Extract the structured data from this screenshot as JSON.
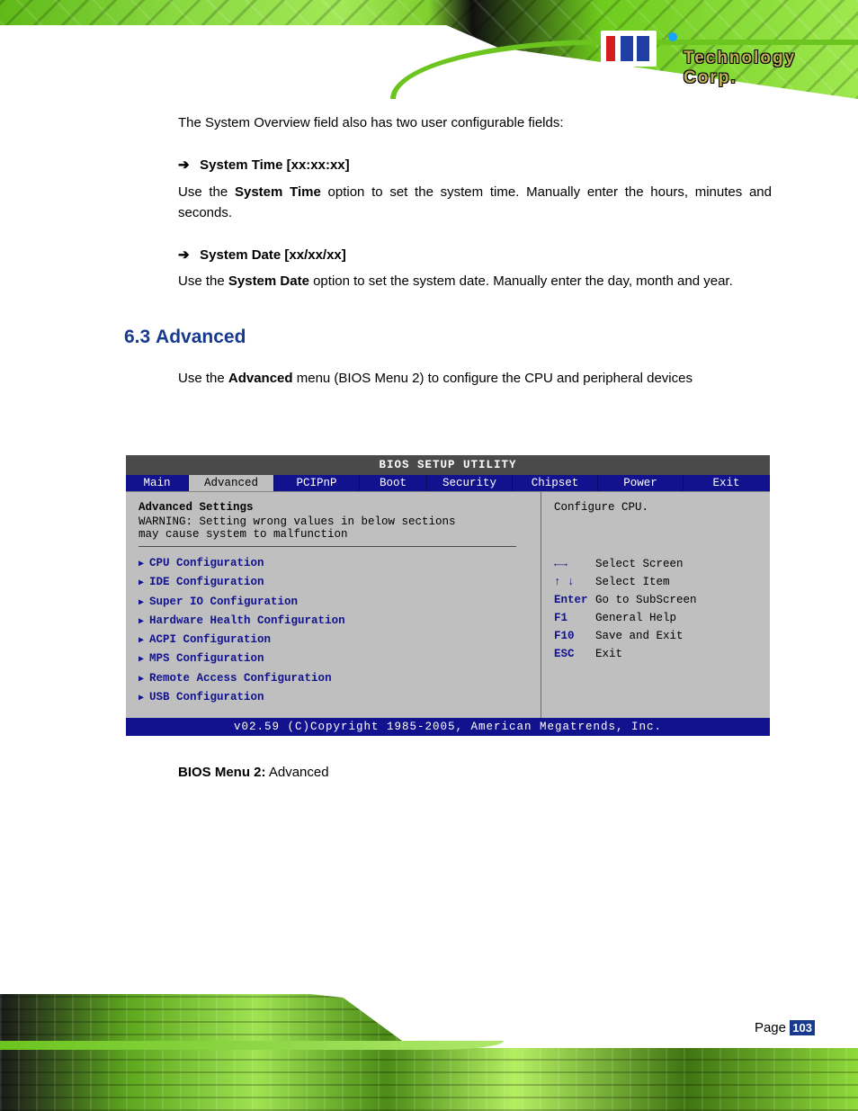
{
  "header": {
    "brand_text": "Technology Corp.",
    "reg": "®"
  },
  "body": {
    "intro": "The System Overview field also has two user configurable fields:",
    "item1": {
      "label": "System Time [xx:xx:xx]",
      "text_before": "Use the ",
      "bold": "System Time",
      "text_after": " option to set the system time. Manually enter the hours, minutes and seconds."
    },
    "item2": {
      "label": "System Date [xx/xx/xx]",
      "text_before": "Use the ",
      "bold": "System Date",
      "text_after": " option to set the system date. Manually enter the day, month and year."
    },
    "section_number": "6.3",
    "section_title": "Advanced",
    "adv_intro_before": "Use the ",
    "adv_intro_bold": "Advanced",
    "adv_intro_after": " menu (BIOS Menu 2) to configure the CPU and peripheral devices"
  },
  "bios": {
    "title": "BIOS SETUP UTILITY",
    "tabs": [
      "Main",
      "Advanced",
      "PCIPnP",
      "Boot",
      "Security",
      "Chipset",
      "Power",
      "Exit"
    ],
    "active_tab_index": 1,
    "left": {
      "heading": "Advanced Settings",
      "warning_line1": "WARNING: Setting wrong values in below sections",
      "warning_line2": "         may cause system to malfunction",
      "menu": [
        "CPU Configuration",
        "IDE Configuration",
        "Super IO Configuration",
        "Hardware Health Configuration",
        "ACPI Configuration",
        "MPS Configuration",
        "Remote Access Configuration",
        "USB Configuration"
      ]
    },
    "right": {
      "help": "Configure CPU.",
      "keys": [
        {
          "sym": "←→",
          "desc": "Select Screen"
        },
        {
          "sym": "↑ ↓",
          "desc": "Select Item"
        },
        {
          "sym": "Enter",
          "desc": "Go to SubScreen"
        },
        {
          "sym": "F1",
          "desc": "General Help"
        },
        {
          "sym": "F10",
          "desc": "Save and Exit"
        },
        {
          "sym": "ESC",
          "desc": "Exit"
        }
      ]
    },
    "footer": "v02.59 (C)Copyright 1985-2005, American Megatrends, Inc.",
    "caption_bold": "BIOS Menu 2:",
    "caption_rest": " Advanced"
  },
  "footer": {
    "page_label": "Page",
    "page_number": "103"
  }
}
